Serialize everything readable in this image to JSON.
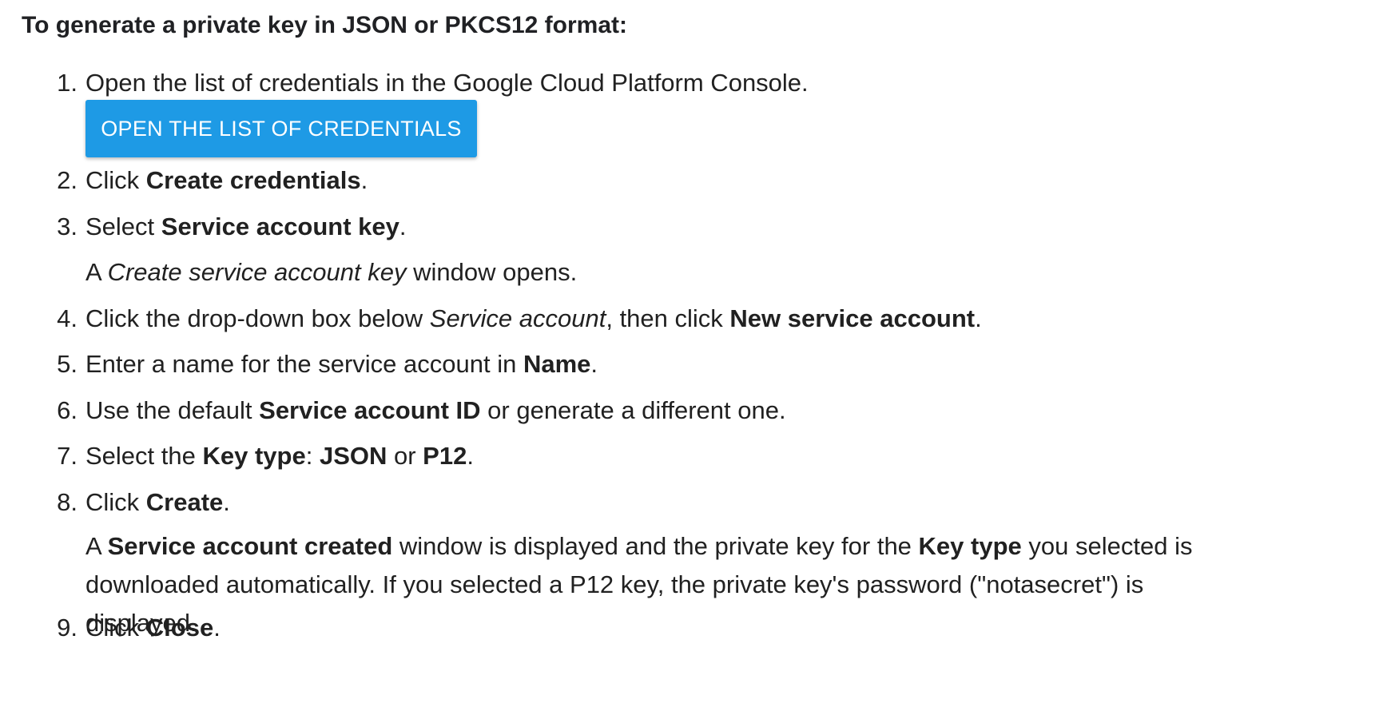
{
  "heading": "To generate a private key in JSON or PKCS12 format:",
  "steps": [
    {
      "num": "1.",
      "text": "Open the list of credentials in the Google Cloud Platform Console."
    },
    {
      "num": "2.",
      "pre": "Click ",
      "b1": "Create credentials",
      "post": "."
    },
    {
      "num": "3.",
      "pre": "Select ",
      "b1": "Service account key",
      "post": "."
    },
    {
      "num": "4.",
      "pre": "Click the drop-down box below ",
      "i1": "Service account",
      "mid": ", then click ",
      "b1": "New service account",
      "post": "."
    },
    {
      "num": "5.",
      "pre": "Enter a name for the service account in ",
      "b1": "Name",
      "post": "."
    },
    {
      "num": "6.",
      "pre": "Use the default ",
      "b1": "Service account ID",
      "post": " or generate a different one."
    },
    {
      "num": "7.",
      "pre": "Select the ",
      "b1": "Key type",
      "mid": ": ",
      "b2": "JSON",
      "mid2": " or ",
      "b3": "P12",
      "post": "."
    },
    {
      "num": "8.",
      "pre": "Click ",
      "b1": "Create",
      "post": "."
    },
    {
      "num": "9.",
      "pre": "Click ",
      "b1": "Close",
      "post": "."
    }
  ],
  "button": {
    "label": "OPEN THE LIST OF CREDENTIALS"
  },
  "note3": {
    "pre": "A ",
    "i1": "Create service account key",
    "post": " window opens."
  },
  "note8": {
    "pre": "A ",
    "b1": "Service account created",
    "mid": " window is displayed and the private key for the ",
    "b2": "Key type",
    "post": " you selected is downloaded automatically. If you selected a P12 key, the private key's password (\"notasecret\") is displayed."
  }
}
